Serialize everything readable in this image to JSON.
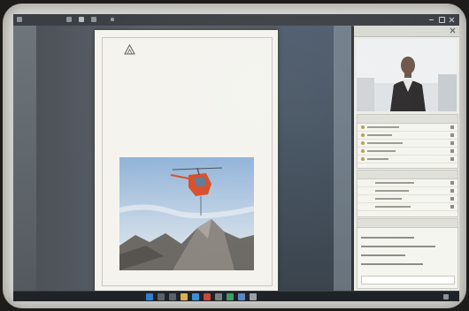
{
  "titlebar": {
    "labels": [
      "",
      "",
      ""
    ]
  },
  "document": {
    "university_lines": [
      "",
      ""
    ],
    "doc_type": "",
    "title": "",
    "subtitle": ""
  },
  "panel": {
    "title": "",
    "participants_header": "",
    "chat_header": ""
  },
  "taskbar": {
    "time": "",
    "date": ""
  },
  "colors": {
    "accent": "#3b3f44",
    "panel_bg": "#ecece6",
    "page_bg": "#f4f3ee",
    "taskbar_bg": "#1f2328"
  },
  "icons": [
    "windows-start-icon",
    "search-icon",
    "file-explorer-icon",
    "browser-icon",
    "close-icon",
    "user-icon",
    "chat-icon",
    "university-logo-icon"
  ]
}
